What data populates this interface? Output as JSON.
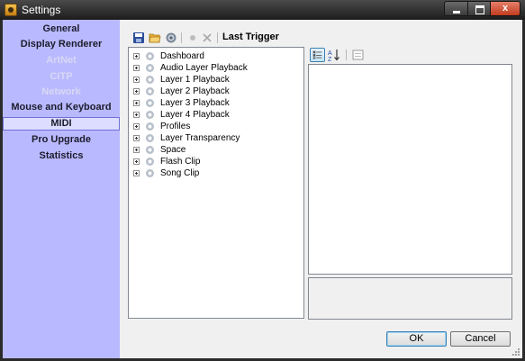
{
  "window": {
    "title": "Settings",
    "minimize_icon": "minimize-icon",
    "maximize_icon": "maximize-icon",
    "close_glyph": "x"
  },
  "sidebar": {
    "items": [
      {
        "label": "General",
        "state": "normal"
      },
      {
        "label": "Display Renderer",
        "state": "normal"
      },
      {
        "label": "ArtNet",
        "state": "disabled"
      },
      {
        "label": "CITP",
        "state": "disabled"
      },
      {
        "label": "Network",
        "state": "disabled"
      },
      {
        "label": "Mouse and Keyboard",
        "state": "normal"
      },
      {
        "label": "MIDI",
        "state": "selected"
      },
      {
        "label": "Pro Upgrade",
        "state": "normal"
      },
      {
        "label": "Statistics",
        "state": "normal"
      }
    ]
  },
  "toolbar": {
    "icons": [
      "save-icon",
      "open-folder-icon",
      "gear-icon",
      "record-icon",
      "delete-icon"
    ],
    "last_trigger_label": "Last Trigger"
  },
  "tree": {
    "nodes": [
      "Dashboard",
      "Audio Layer Playback",
      "Layer 1 Playback",
      "Layer 2 Playback",
      "Layer 3 Playback",
      "Layer 4 Playback",
      "Profiles",
      "Layer Transparency",
      "Space",
      "Flash Clip",
      "Song Clip"
    ]
  },
  "properties": {
    "toolbar_icons": [
      "categorized-icon",
      "sort-alphabetical-icon",
      "property-pages-icon"
    ]
  },
  "buttons": {
    "ok": "OK",
    "cancel": "Cancel"
  },
  "colors": {
    "sidebar_bg": "#b9b9ff",
    "sidebar_selected_bg": "#ddddff",
    "sidebar_disabled_text": "#d8d8f4",
    "close_button": "#c23b1f",
    "titlebar": "#2b2b2b"
  }
}
